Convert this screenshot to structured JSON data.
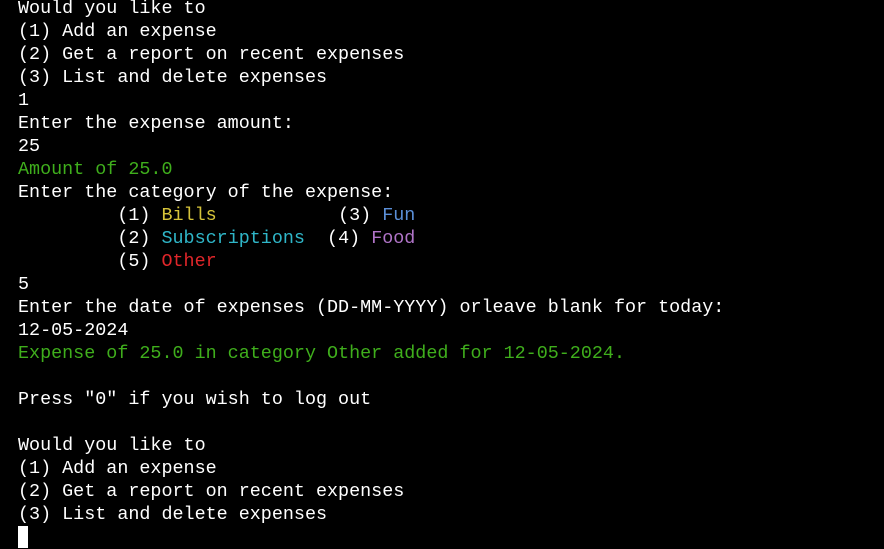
{
  "terminal": {
    "lines": {
      "l0": "Would you like to",
      "l1": "(1) Add an expense",
      "l2": "(2) Get a report on recent expenses",
      "l3": "(3) List and delete expenses",
      "l4": "1",
      "l5": "Enter the expense amount:",
      "l6": "25",
      "l7": "Amount of 25.0",
      "l8": "Enter the category of the expense:",
      "l13": "5",
      "l14": "Enter the date of expenses (DD-MM-YYYY) orleave blank for today:",
      "l15": "12-05-2024",
      "l16": "Expense of 25.0 in category Other added for 12-05-2024.",
      "l18": "Press \"0\" if you wish to log out",
      "l20": "Would you like to",
      "l21": "(1) Add an expense",
      "l22": "(2) Get a report on recent expenses",
      "l23": "(3) List and delete expenses"
    },
    "categories": {
      "c1_num": "(1)",
      "c1_label": "Bills",
      "c2_num": "(2)",
      "c2_label": "Subscriptions",
      "c3_num": "(3)",
      "c3_label": "Fun",
      "c4_num": "(4)",
      "c4_label": "Food",
      "c5_num": "(5)",
      "c5_label": "Other"
    }
  },
  "colors": {
    "background": "#000000",
    "text": "#ffffff",
    "success_green": "#3fae1c",
    "bills_yellow": "#d6c43a",
    "subscriptions_cyan": "#2fb6c8",
    "fun_blue": "#5b8fd8",
    "food_purple": "#b074c8",
    "other_red": "#e0262a"
  }
}
